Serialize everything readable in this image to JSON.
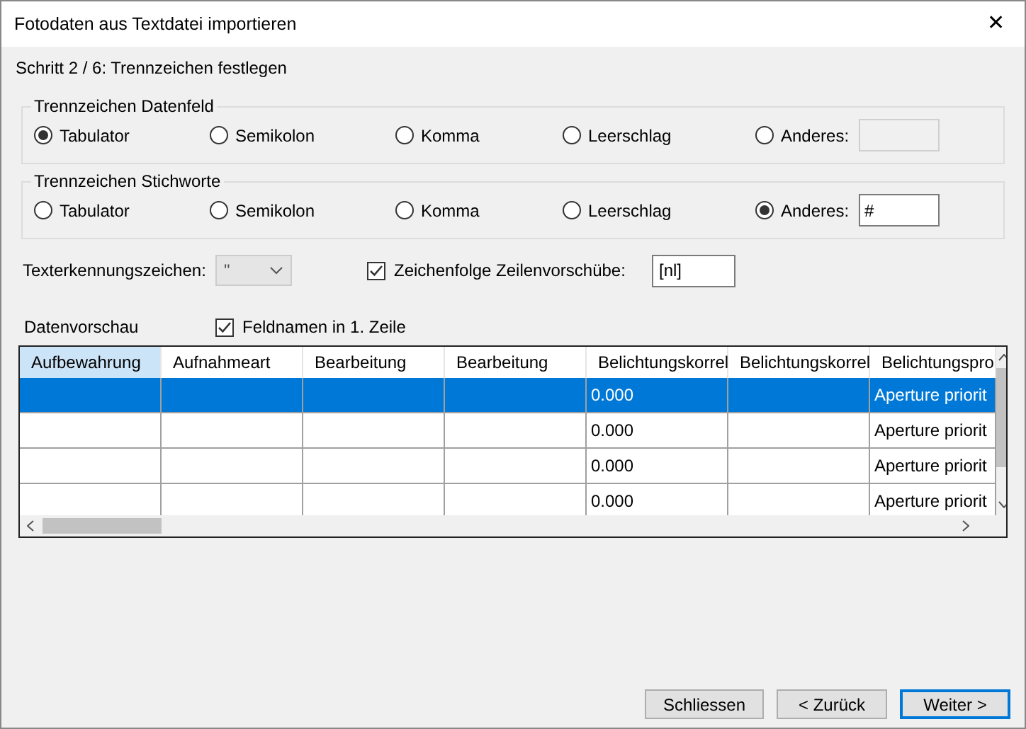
{
  "window": {
    "title": "Fotodaten aus Textdatei importieren",
    "close": "✕"
  },
  "step": "Schritt 2 / 6: Trennzeichen festlegen",
  "groups": [
    {
      "legend": "Trennzeichen Datenfeld",
      "options": [
        {
          "label": "Tabulator",
          "selected": true
        },
        {
          "label": "Semikolon",
          "selected": false
        },
        {
          "label": "Komma",
          "selected": false
        },
        {
          "label": "Leerschlag",
          "selected": false
        },
        {
          "label": "Anderes:",
          "selected": false
        }
      ],
      "other": {
        "disabled": true
      }
    },
    {
      "legend": "Trennzeichen Stichworte",
      "options": [
        {
          "label": "Tabulator",
          "selected": false
        },
        {
          "label": "Semikolon",
          "selected": false
        },
        {
          "label": "Komma",
          "selected": false
        },
        {
          "label": "Leerschlag",
          "selected": false
        },
        {
          "label": "Anderes:",
          "selected": true
        }
      ],
      "other": {
        "value": "#",
        "disabled": false
      }
    }
  ],
  "text_qualifier": {
    "label": "Texterkennungszeichen:",
    "value": "\"",
    "disabled": true
  },
  "linebreak": {
    "label": "Zeichenfolge Zeilenvorschübe:",
    "checked": true,
    "value": "[nl]"
  },
  "preview": {
    "label": "Datenvorschau",
    "header_row": {
      "label": "Feldnamen in 1. Zeile",
      "checked": true
    }
  },
  "table": {
    "columns": [
      {
        "label": "Aufbewahrung",
        "selected": true
      },
      {
        "label": "Aufnahmeart",
        "selected": false
      },
      {
        "label": "Bearbeitung",
        "selected": false
      },
      {
        "label": "Bearbeitung",
        "selected": false
      },
      {
        "label": "Belichtungskorrel",
        "selected": false
      },
      {
        "label": "Belichtungskorrel",
        "selected": false
      },
      {
        "label": "Belichtungspro",
        "selected": false
      }
    ],
    "rows": [
      {
        "selected": true,
        "cells": [
          null,
          null,
          null,
          null,
          "0.000",
          null,
          "Aperture priorit"
        ]
      },
      {
        "selected": false,
        "cells": [
          null,
          null,
          null,
          null,
          "0.000",
          null,
          "Aperture priorit"
        ]
      },
      {
        "selected": false,
        "cells": [
          null,
          null,
          null,
          null,
          "0.000",
          null,
          "Aperture priorit"
        ]
      },
      {
        "selected": false,
        "cells": [
          null,
          null,
          null,
          null,
          "0.000",
          null,
          "Aperture priorit"
        ]
      }
    ]
  },
  "buttons": [
    {
      "label": "Schliessen",
      "default": false
    },
    {
      "label": "< Zurück",
      "default": false
    },
    {
      "label": "Weiter >",
      "default": true
    }
  ]
}
